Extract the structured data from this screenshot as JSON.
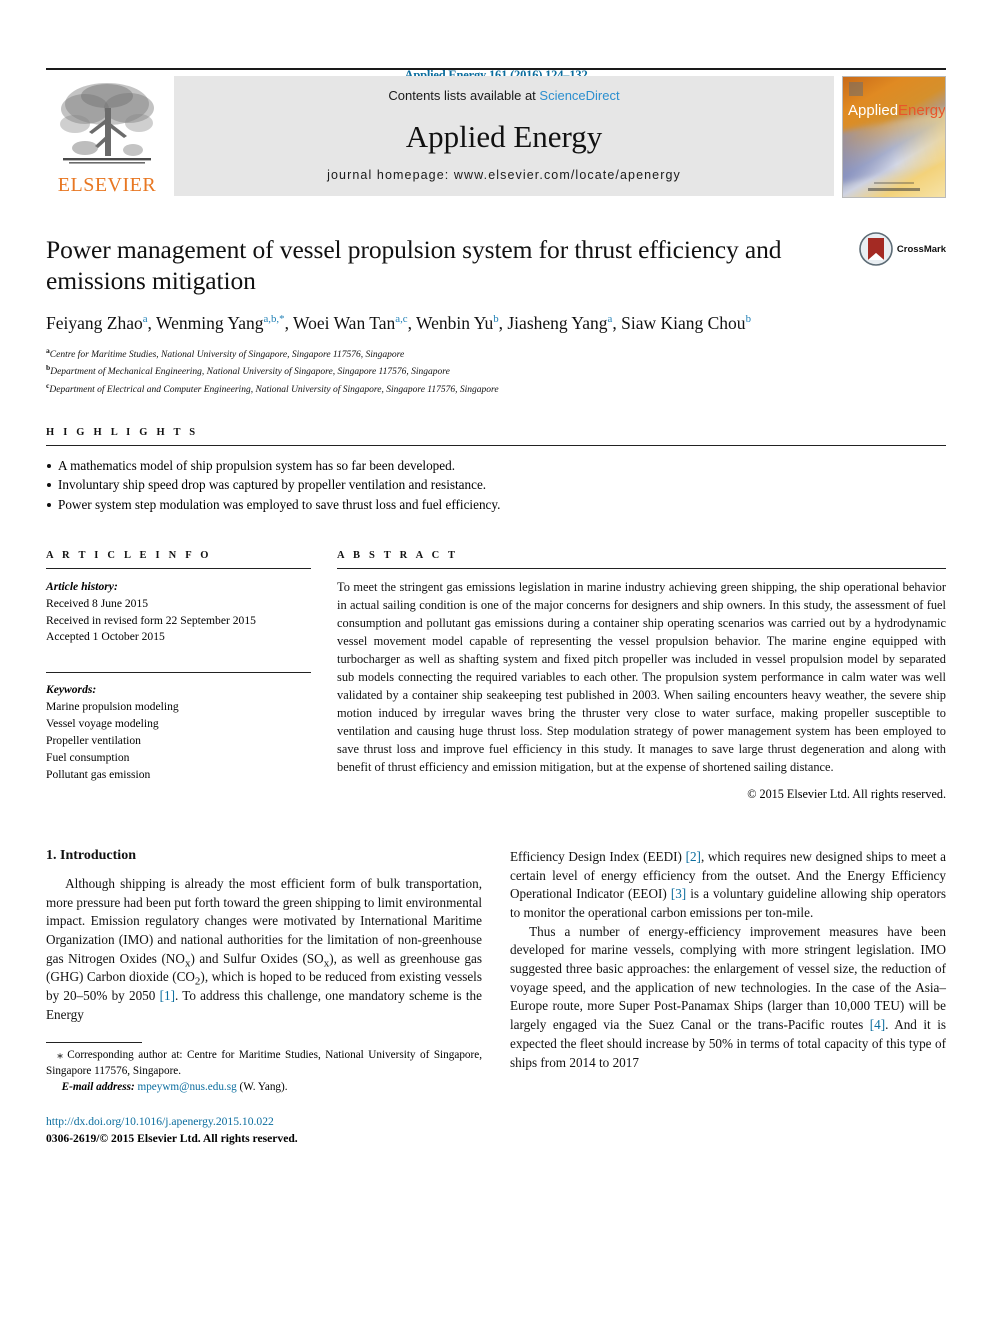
{
  "running_head": "Applied Energy 161 (2016) 124–132",
  "masthead": {
    "publisher_logo_text": "ELSEVIER",
    "contents_prefix": "Contents lists available at ",
    "contents_link": "ScienceDirect",
    "journal_title": "Applied Energy",
    "homepage": "journal homepage: www.elsevier.com/locate/apenergy",
    "cover": {
      "title_first": "Applied",
      "title_second": "Energy"
    }
  },
  "article": {
    "title": "Power management of vessel propulsion system for thrust efficiency and emissions mitigation",
    "crossmark_label": "CrossMark",
    "authors": [
      {
        "name": "Feiyang Zhao",
        "marks": "a",
        "sep": ", "
      },
      {
        "name": "Wenming Yang",
        "marks": "a,b,*",
        "sep": ", "
      },
      {
        "name": "Woei Wan Tan",
        "marks": "a,c",
        "sep": ", "
      },
      {
        "name": "Wenbin Yu",
        "marks": "b",
        "sep": ", "
      },
      {
        "name": "Jiasheng Yang",
        "marks": "a",
        "sep": ", "
      },
      {
        "name": "Siaw Kiang Chou",
        "marks": "b",
        "sep": ""
      }
    ],
    "affiliations": [
      {
        "mark": "a",
        "text": "Centre for Maritime Studies, National University of Singapore, Singapore 117576, Singapore"
      },
      {
        "mark": "b",
        "text": "Department of Mechanical Engineering, National University of Singapore, Singapore 117576, Singapore"
      },
      {
        "mark": "c",
        "text": "Department of Electrical and Computer Engineering, National University of Singapore, Singapore 117576, Singapore"
      }
    ]
  },
  "highlights": {
    "heading": "H I G H L I G H T S",
    "items": [
      "A mathematics model of ship propulsion system has so far been developed.",
      "Involuntary ship speed drop was captured by propeller ventilation and resistance.",
      "Power system step modulation was employed to save thrust loss and fuel efficiency."
    ]
  },
  "article_info": {
    "heading": "A R T I C L E   I N F O",
    "history_label": "Article history:",
    "history": [
      "Received 8 June 2015",
      "Received in revised form 22 September 2015",
      "Accepted 1 October 2015"
    ],
    "keywords_label": "Keywords:",
    "keywords": [
      "Marine propulsion modeling",
      "Vessel voyage modeling",
      "Propeller ventilation",
      "Fuel consumption",
      "Pollutant gas emission"
    ]
  },
  "abstract": {
    "heading": "A B S T R A C T",
    "text": "To meet the stringent gas emissions legislation in marine industry achieving green shipping, the ship operational behavior in actual sailing condition is one of the major concerns for designers and ship owners. In this study, the assessment of fuel consumption and pollutant gas emissions during a container ship operating scenarios was carried out by a hydrodynamic vessel movement model capable of representing the vessel propulsion behavior. The marine engine equipped with turbocharger as well as shafting system and fixed pitch propeller was included in vessel propulsion model by separated sub models connecting the required variables to each other. The propulsion system performance in calm water was well validated by a container ship seakeeping test published in 2003. When sailing encounters heavy weather, the severe ship motion induced by irregular waves bring the thruster very close to water surface, making propeller susceptible to ventilation and causing huge thrust loss. Step modulation strategy of power management system has been employed to save thrust loss and improve fuel efficiency in this study. It manages to save large thrust degeneration and along with benefit of thrust efficiency and emission mitigation, but at the expense of shortened sailing distance.",
    "copyright": "© 2015 Elsevier Ltd. All rights reserved."
  },
  "introduction": {
    "heading": "1. Introduction",
    "left_p1_a": "Although shipping is already the most efficient form of bulk transportation, more pressure had been put forth toward the green shipping to limit environmental impact. Emission regulatory changes were motivated by International Maritime Organization (IMO) and national authorities for the limitation of non-greenhouse gas Nitrogen Oxides (NO",
    "left_p1_sub1": "x",
    "left_p1_b": ") and Sulfur Oxides (SO",
    "left_p1_sub2": "x",
    "left_p1_c": "), as well as greenhouse gas (GHG) Carbon dioxide (CO",
    "left_p1_sub3": "2",
    "left_p1_d": "), which is hoped to be reduced from existing vessels by 20–50% by 2050 ",
    "left_p1_ref": "[1]",
    "left_p1_e": ". To address this challenge, one mandatory scheme is the Energy",
    "right_p1_a": "Efficiency Design Index (EEDI) ",
    "right_p1_ref1": "[2]",
    "right_p1_b": ", which requires new designed ships to meet a certain level of energy efficiency from the outset. And the Energy Efficiency Operational Indicator (EEOI) ",
    "right_p1_ref2": "[3]",
    "right_p1_c": " is a voluntary guideline allowing ship operators to monitor the operational carbon emissions per ton-mile.",
    "right_p2_a": "Thus a number of energy-efficiency improvement measures have been developed for marine vessels, complying with more stringent legislation. IMO suggested three basic approaches: the enlargement of vessel size, the reduction of voyage speed, and the application of new technologies. In the case of the Asia–Europe route, more Super Post-Panamax Ships (larger than 10,000 TEU) will be largely engaged via the Suez Canal or the trans-Pacific routes ",
    "right_p2_ref": "[4]",
    "right_p2_b": ". And it is expected the fleet should increase by 50% in terms of total capacity of this type of ships from 2014 to 2017"
  },
  "footnote": {
    "marker": "⁎",
    "corresponding": " Corresponding author at: Centre for Maritime Studies, National University of Singapore, Singapore 117576, Singapore.",
    "email_label": "E-mail address:",
    "email": "mpeywm@nus.edu.sg",
    "email_author": " (W. Yang)."
  },
  "footer": {
    "doi": "http://dx.doi.org/10.1016/j.apenergy.2015.10.022",
    "issn_line_a": "0306-2619/",
    "issn_line_b": "© 2015 Elsevier Ltd. All rights reserved."
  },
  "colors": {
    "link": "#0b6d9e",
    "sciencedirect": "#2b8fcf",
    "elsevier_orange": "#e87722",
    "masthead_bg": "#e6e6e6",
    "crossmark_red": "#a42a23"
  }
}
